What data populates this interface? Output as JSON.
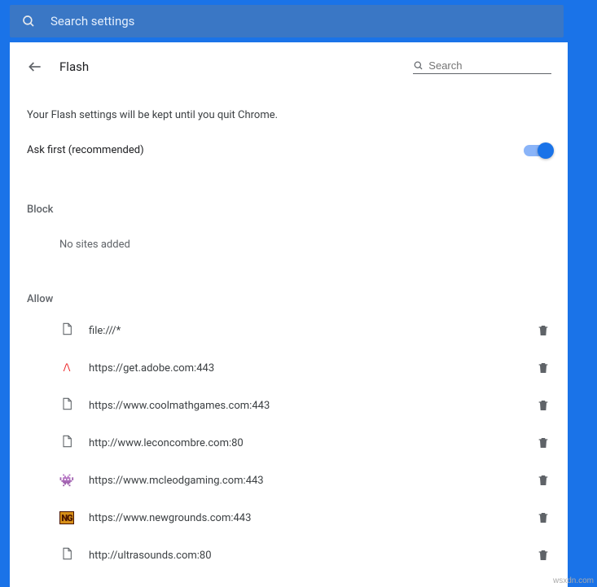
{
  "topbar": {
    "search_placeholder": "Search settings"
  },
  "header": {
    "title": "Flash",
    "inline_search_placeholder": "Search"
  },
  "info_text": "Your Flash settings will be kept until you quit Chrome.",
  "toggle": {
    "label": "Ask first (recommended)",
    "enabled": true
  },
  "block": {
    "label": "Block",
    "empty_text": "No sites added",
    "sites": []
  },
  "allow": {
    "label": "Allow",
    "sites": [
      {
        "url": "file:///*",
        "icon": "doc"
      },
      {
        "url": "https://get.adobe.com:443",
        "icon": "adobe"
      },
      {
        "url": "https://www.coolmathgames.com:443",
        "icon": "doc"
      },
      {
        "url": "http://www.leconcombre.com:80",
        "icon": "doc"
      },
      {
        "url": "https://www.mcleodgaming.com:443",
        "icon": "mg"
      },
      {
        "url": "https://www.newgrounds.com:443",
        "icon": "ng"
      },
      {
        "url": "http://ultrasounds.com:80",
        "icon": "doc"
      }
    ]
  },
  "watermark": "wsxdn.com"
}
